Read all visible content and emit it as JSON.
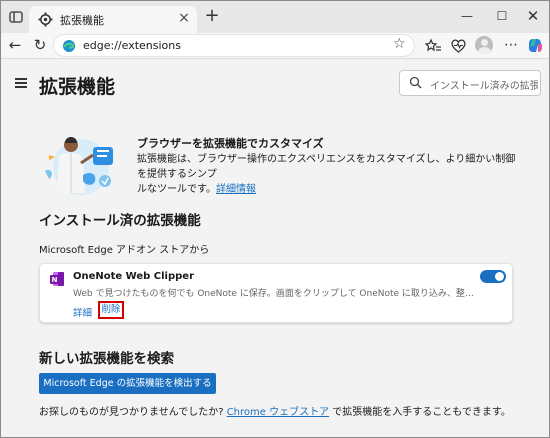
{
  "tab": {
    "title": "拡張機能"
  },
  "address": {
    "url": "edge://extensions"
  },
  "page": {
    "title": "拡張機能",
    "search_placeholder": "インストール済みの拡張機..."
  },
  "promo": {
    "title": "ブラウザーを拡張機能でカスタマイズ",
    "desc_line1": "拡張機能は、ブラウザー操作のエクスペリエンスをカスタマイズし、より細かい制御を提供するシンプ",
    "desc_line2": "ルなツールです。",
    "learn_more": "詳細情報"
  },
  "installed": {
    "title": "インストール済の拡張機能",
    "source": "Microsoft Edge アドオン ストアから",
    "extensions": [
      {
        "name": "OneNote Web Clipper",
        "description": "Web で見つけたものを何でも OneNote に保存。画面をクリップして OneNote に取り込み、整理し、編集。保存したクリッ...",
        "enabled": true,
        "details_label": "詳細",
        "remove_label": "削除"
      }
    ]
  },
  "find": {
    "title": "新しい拡張機能を検索",
    "button_label": "Microsoft Edge の拡張機能を検出する",
    "text_before": "お探しのものが見つかりませんでしたか? ",
    "chrome_store_link": "Chrome ウェブストア",
    "text_after": " で拡張機能を入手することもできます。"
  },
  "colors": {
    "accent": "#1a6fc2",
    "highlight_box": "#d40000",
    "onenote": "#7719aa"
  }
}
